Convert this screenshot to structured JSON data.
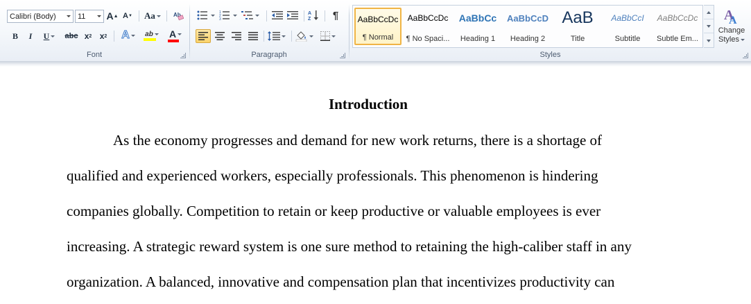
{
  "ribbon": {
    "font": {
      "label": "Font",
      "font_name": "Calibri (Body)",
      "font_size": "11",
      "grow_font": "A",
      "shrink_font": "A",
      "change_case": "Aa",
      "bold": "B",
      "italic": "I",
      "underline": "U",
      "strikethrough": "abc",
      "subscript": "x",
      "superscript": "x",
      "sub_mark": "2",
      "sup_mark": "2",
      "text_effects": "A",
      "highlight": "ab",
      "font_color": "A",
      "highlight_color": "#ffff00",
      "font_color_value": "#ff0000"
    },
    "paragraph": {
      "label": "Paragraph",
      "pilcrow": "¶"
    },
    "styles": {
      "label": "Styles",
      "items": [
        {
          "preview": "AaBbCcDc",
          "name": "¶ Normal"
        },
        {
          "preview": "AaBbCcDc",
          "name": "¶ No Spaci..."
        },
        {
          "preview": "AaBbCc",
          "name": "Heading 1"
        },
        {
          "preview": "AaBbCcD",
          "name": "Heading 2"
        },
        {
          "preview": "AaB",
          "name": "Title"
        },
        {
          "preview": "AaBbCcI",
          "name": "Subtitle"
        },
        {
          "preview": "AaBbCcDc",
          "name": "Subtle Em..."
        }
      ],
      "change_styles_line1": "Change",
      "change_styles_line2": "Styles"
    },
    "colors": {
      "heading_blue": "#2e74b5",
      "heading2_blue": "#4f81bd",
      "subtitle_blue": "#4f81bd",
      "selected_border": "#f0b445"
    }
  },
  "document": {
    "title": "Introduction",
    "lines": [
      "As the economy progresses and demand for new work returns, there is a shortage of",
      "qualified and experienced workers, especially professionals. This phenomenon is hindering",
      "companies globally. Competition to retain or keep productive or valuable employees is ever",
      "increasing. A strategic reward system is one sure method to retaining the high-caliber staff in any",
      "organization. A balanced, innovative and compensation plan that incentivizes productivity can"
    ]
  }
}
